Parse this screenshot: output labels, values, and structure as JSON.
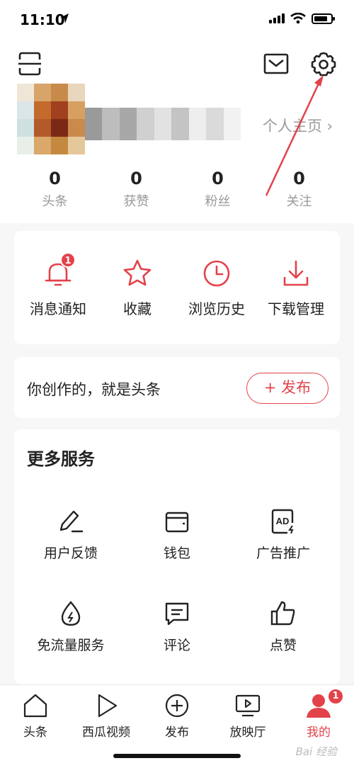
{
  "status": {
    "time": "11:10"
  },
  "profile": {
    "link_label": "个人主页 ›",
    "stats": [
      {
        "num": "0",
        "label": "头条"
      },
      {
        "num": "0",
        "label": "获赞"
      },
      {
        "num": "0",
        "label": "粉丝"
      },
      {
        "num": "0",
        "label": "关注"
      }
    ]
  },
  "quick": {
    "items": [
      {
        "label": "消息通知",
        "badge": "1"
      },
      {
        "label": "收藏"
      },
      {
        "label": "浏览历史"
      },
      {
        "label": "下载管理"
      }
    ]
  },
  "create": {
    "text": "你创作的，就是头条",
    "button": "+ 发布"
  },
  "services": {
    "title": "更多服务",
    "items": [
      {
        "label": "用户反馈",
        "icon": "pen-icon"
      },
      {
        "label": "钱包",
        "icon": "wallet-icon"
      },
      {
        "label": "广告推广",
        "icon": "ad-icon"
      },
      {
        "label": "免流量服务",
        "icon": "data-saver-icon"
      },
      {
        "label": "评论",
        "icon": "comment-icon"
      },
      {
        "label": "点赞",
        "icon": "thumbs-up-icon"
      }
    ]
  },
  "tabs": [
    {
      "label": "头条",
      "icon": "home-icon"
    },
    {
      "label": "西瓜视频",
      "icon": "play-icon"
    },
    {
      "label": "发布",
      "icon": "add-icon"
    },
    {
      "label": "放映厅",
      "icon": "screen-icon"
    },
    {
      "label": "我的",
      "icon": "user-icon",
      "active": true,
      "badge": "1"
    }
  ],
  "watermark": "Bai 经验",
  "colors": {
    "accent": "#e3424a",
    "background": "#f7f7f7"
  }
}
